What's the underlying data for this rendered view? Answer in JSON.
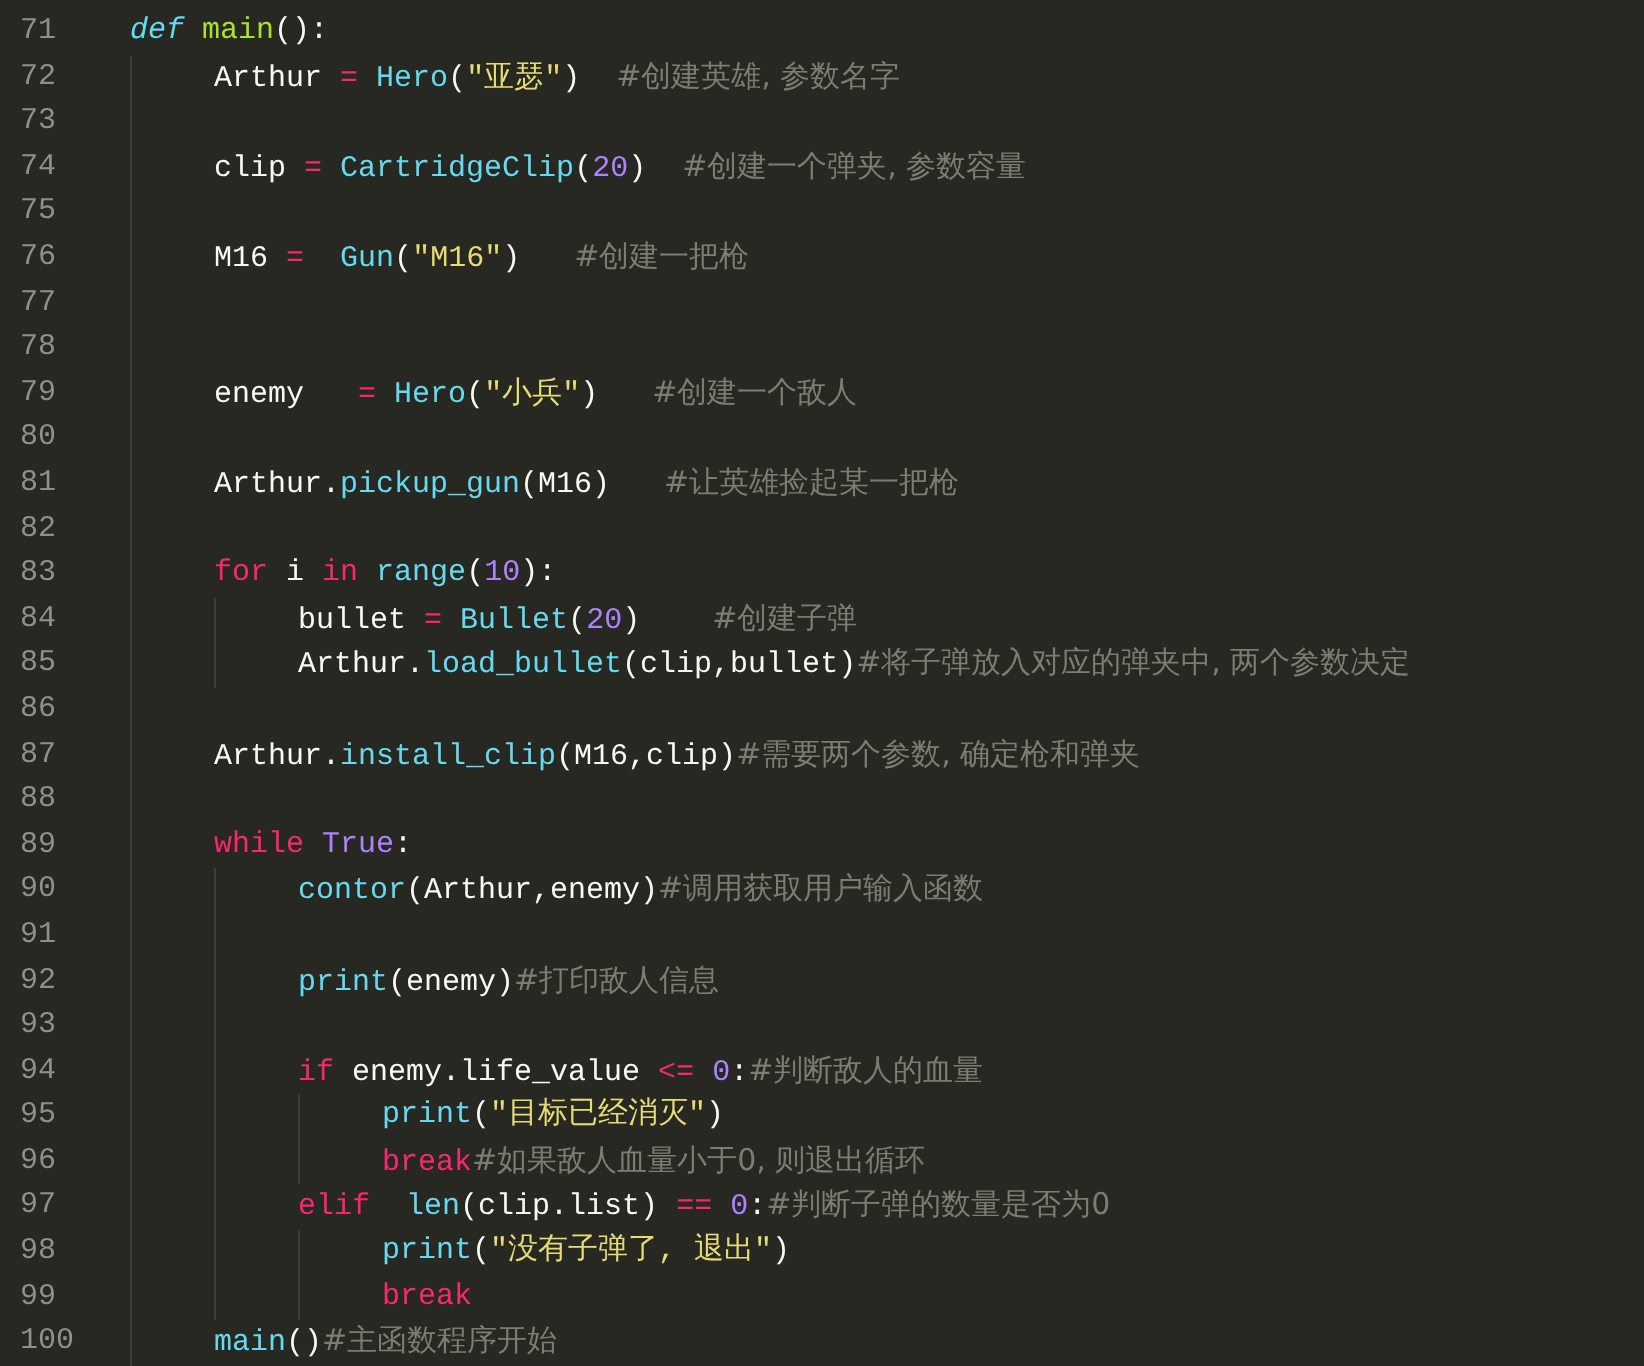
{
  "editor": {
    "lines": [
      {
        "n": "71",
        "tokens": [
          {
            "t": "def ",
            "kind": "def"
          },
          {
            "t": "main",
            "kind": "name"
          },
          {
            "t": "():",
            "kind": "plain"
          }
        ],
        "children": [
          {
            "n": "72",
            "tokens": [
              {
                "t": "Arthur ",
                "kind": "plain"
              },
              {
                "t": "= ",
                "kind": "op"
              },
              {
                "t": "Hero",
                "kind": "fn"
              },
              {
                "t": "(",
                "kind": "plain"
              },
              {
                "t": "\"亚瑟\"",
                "kind": "str"
              },
              {
                "t": ")  ",
                "kind": "plain"
              },
              {
                "t": "#创建英雄, 参数名字",
                "kind": "com"
              }
            ]
          },
          {
            "n": "73"
          },
          {
            "n": "74",
            "tokens": [
              {
                "t": "clip ",
                "kind": "plain"
              },
              {
                "t": "= ",
                "kind": "op"
              },
              {
                "t": "CartridgeClip",
                "kind": "fn"
              },
              {
                "t": "(",
                "kind": "plain"
              },
              {
                "t": "20",
                "kind": "num"
              },
              {
                "t": ")  ",
                "kind": "plain"
              },
              {
                "t": "#创建一个弹夹, 参数容量",
                "kind": "com"
              }
            ]
          },
          {
            "n": "75"
          },
          {
            "n": "76",
            "tokens": [
              {
                "t": "M16 ",
                "kind": "plain"
              },
              {
                "t": "=  ",
                "kind": "op"
              },
              {
                "t": "Gun",
                "kind": "fn"
              },
              {
                "t": "(",
                "kind": "plain"
              },
              {
                "t": "\"M16\"",
                "kind": "str"
              },
              {
                "t": ")   ",
                "kind": "plain"
              },
              {
                "t": "#创建一把枪",
                "kind": "com"
              }
            ]
          },
          {
            "n": "77"
          },
          {
            "n": "78"
          },
          {
            "n": "79",
            "tokens": [
              {
                "t": "enemy   ",
                "kind": "plain"
              },
              {
                "t": "= ",
                "kind": "op"
              },
              {
                "t": "Hero",
                "kind": "fn"
              },
              {
                "t": "(",
                "kind": "plain"
              },
              {
                "t": "\"小兵\"",
                "kind": "str"
              },
              {
                "t": ")   ",
                "kind": "plain"
              },
              {
                "t": "#创建一个敌人",
                "kind": "com"
              }
            ]
          },
          {
            "n": "80"
          },
          {
            "n": "81",
            "tokens": [
              {
                "t": "Arthur.",
                "kind": "plain"
              },
              {
                "t": "pickup_gun",
                "kind": "fn"
              },
              {
                "t": "(M16)   ",
                "kind": "plain"
              },
              {
                "t": "#让英雄捡起某一把枪",
                "kind": "com"
              }
            ]
          },
          {
            "n": "82"
          },
          {
            "n": "83",
            "tokens": [
              {
                "t": "for",
                "kind": "kw"
              },
              {
                "t": " i ",
                "kind": "plain"
              },
              {
                "t": "in ",
                "kind": "kw"
              },
              {
                "t": "range",
                "kind": "fn"
              },
              {
                "t": "(",
                "kind": "plain"
              },
              {
                "t": "10",
                "kind": "num"
              },
              {
                "t": "):",
                "kind": "plain"
              }
            ],
            "children": [
              {
                "n": "84",
                "tokens": [
                  {
                    "t": "bullet ",
                    "kind": "plain"
                  },
                  {
                    "t": "= ",
                    "kind": "op"
                  },
                  {
                    "t": "Bullet",
                    "kind": "fn"
                  },
                  {
                    "t": "(",
                    "kind": "plain"
                  },
                  {
                    "t": "20",
                    "kind": "num"
                  },
                  {
                    "t": ")    ",
                    "kind": "plain"
                  },
                  {
                    "t": "#创建子弹",
                    "kind": "com"
                  }
                ]
              },
              {
                "n": "85",
                "tokens": [
                  {
                    "t": "Arthur.",
                    "kind": "plain"
                  },
                  {
                    "t": "load_bullet",
                    "kind": "fn"
                  },
                  {
                    "t": "(clip,bullet)",
                    "kind": "plain"
                  },
                  {
                    "t": "#将子弹放入对应的弹夹中, 两个参数决定",
                    "kind": "com"
                  }
                ]
              }
            ]
          },
          {
            "n": "86"
          },
          {
            "n": "87",
            "tokens": [
              {
                "t": "Arthur.",
                "kind": "plain"
              },
              {
                "t": "install_clip",
                "kind": "fn"
              },
              {
                "t": "(M16,clip)",
                "kind": "plain"
              },
              {
                "t": "#需要两个参数, 确定枪和弹夹",
                "kind": "com"
              }
            ]
          },
          {
            "n": "88"
          },
          {
            "n": "89",
            "tokens": [
              {
                "t": "while ",
                "kind": "kw"
              },
              {
                "t": "True",
                "kind": "const"
              },
              {
                "t": ":",
                "kind": "plain"
              }
            ],
            "children": [
              {
                "n": "90",
                "tokens": [
                  {
                    "t": "contor",
                    "kind": "fn"
                  },
                  {
                    "t": "(Arthur,enemy)",
                    "kind": "plain"
                  },
                  {
                    "t": "#调用获取用户输入函数",
                    "kind": "com"
                  }
                ]
              },
              {
                "n": "91"
              },
              {
                "n": "92",
                "tokens": [
                  {
                    "t": "print",
                    "kind": "fn"
                  },
                  {
                    "t": "(enemy)",
                    "kind": "plain"
                  },
                  {
                    "t": "#打印敌人信息",
                    "kind": "com"
                  }
                ]
              },
              {
                "n": "93"
              },
              {
                "n": "94",
                "tokens": [
                  {
                    "t": "if",
                    "kind": "kw"
                  },
                  {
                    "t": " enemy.life_value ",
                    "kind": "plain"
                  },
                  {
                    "t": "<= ",
                    "kind": "op"
                  },
                  {
                    "t": "0",
                    "kind": "num"
                  },
                  {
                    "t": ":",
                    "kind": "plain"
                  },
                  {
                    "t": "#判断敌人的血量",
                    "kind": "com"
                  }
                ],
                "children": [
                  {
                    "n": "95",
                    "tokens": [
                      {
                        "t": "print",
                        "kind": "fn"
                      },
                      {
                        "t": "(",
                        "kind": "plain"
                      },
                      {
                        "t": "\"目标已经消灭\"",
                        "kind": "str"
                      },
                      {
                        "t": ")",
                        "kind": "plain"
                      }
                    ]
                  },
                  {
                    "n": "96",
                    "tokens": [
                      {
                        "t": "break",
                        "kind": "kw"
                      },
                      {
                        "t": "#如果敌人血量小于0, 则退出循环",
                        "kind": "com"
                      }
                    ]
                  }
                ]
              },
              {
                "n": "97",
                "tokens": [
                  {
                    "t": "elif  ",
                    "kind": "kw"
                  },
                  {
                    "t": "len",
                    "kind": "fn"
                  },
                  {
                    "t": "(clip.list) ",
                    "kind": "plain"
                  },
                  {
                    "t": "== ",
                    "kind": "op"
                  },
                  {
                    "t": "0",
                    "kind": "num"
                  },
                  {
                    "t": ":",
                    "kind": "plain"
                  },
                  {
                    "t": "#判断子弹的数量是否为0",
                    "kind": "com"
                  }
                ],
                "children": [
                  {
                    "n": "98",
                    "tokens": [
                      {
                        "t": "print",
                        "kind": "fn"
                      },
                      {
                        "t": "(",
                        "kind": "plain"
                      },
                      {
                        "t": "\"没有子弹了, 退出\"",
                        "kind": "str"
                      },
                      {
                        "t": ")",
                        "kind": "plain"
                      }
                    ]
                  },
                  {
                    "n": "99",
                    "tokens": [
                      {
                        "t": "break",
                        "kind": "kw"
                      }
                    ]
                  }
                ]
              }
            ]
          },
          {
            "n": "100",
            "tokens": [
              {
                "t": "main",
                "kind": "fn"
              },
              {
                "t": "()",
                "kind": "plain"
              },
              {
                "t": "#主函数程序开始",
                "kind": "com"
              }
            ]
          }
        ]
      }
    ]
  }
}
